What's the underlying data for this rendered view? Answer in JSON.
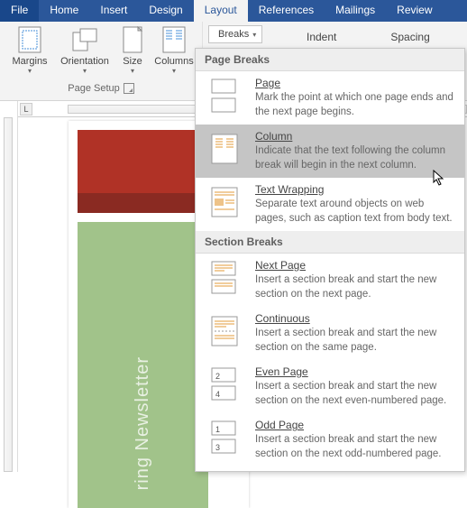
{
  "tabs": {
    "file": "File",
    "home": "Home",
    "insert": "Insert",
    "design": "Design",
    "layout": "Layout",
    "references": "References",
    "mailings": "Mailings",
    "review": "Review"
  },
  "ribbon": {
    "margins": "Margins",
    "orientation": "Orientation",
    "size": "Size",
    "columns": "Columns",
    "group_label": "Page Setup",
    "breaks_btn": "Breaks",
    "indent_label": "Indent",
    "spacing_label": "Spacing"
  },
  "ruler": {
    "corner": "L"
  },
  "document": {
    "sidebar_text": "ring Newsletter"
  },
  "panel": {
    "header_page": "Page Breaks",
    "header_section": "Section Breaks",
    "items": {
      "page": {
        "title": "Page",
        "desc": "Mark the point at which one page ends and the next page begins."
      },
      "column": {
        "title": "Column",
        "desc": "Indicate that the text following the column break will begin in the next column."
      },
      "textwrap": {
        "title": "Text Wrapping",
        "desc": "Separate text around objects on web pages, such as caption text from body text."
      },
      "nextpage": {
        "title": "Next Page",
        "desc": "Insert a section break and start the new section on the next page."
      },
      "continuous": {
        "title": "Continuous",
        "desc": "Insert a section break and start the new section on the same page."
      },
      "evenpage": {
        "title": "Even Page",
        "desc": "Insert a section break and start the new section on the next even-numbered page."
      },
      "oddpage": {
        "title": "Odd Page",
        "desc": "Insert a section break and start the new section on the next odd-numbered page."
      }
    }
  }
}
